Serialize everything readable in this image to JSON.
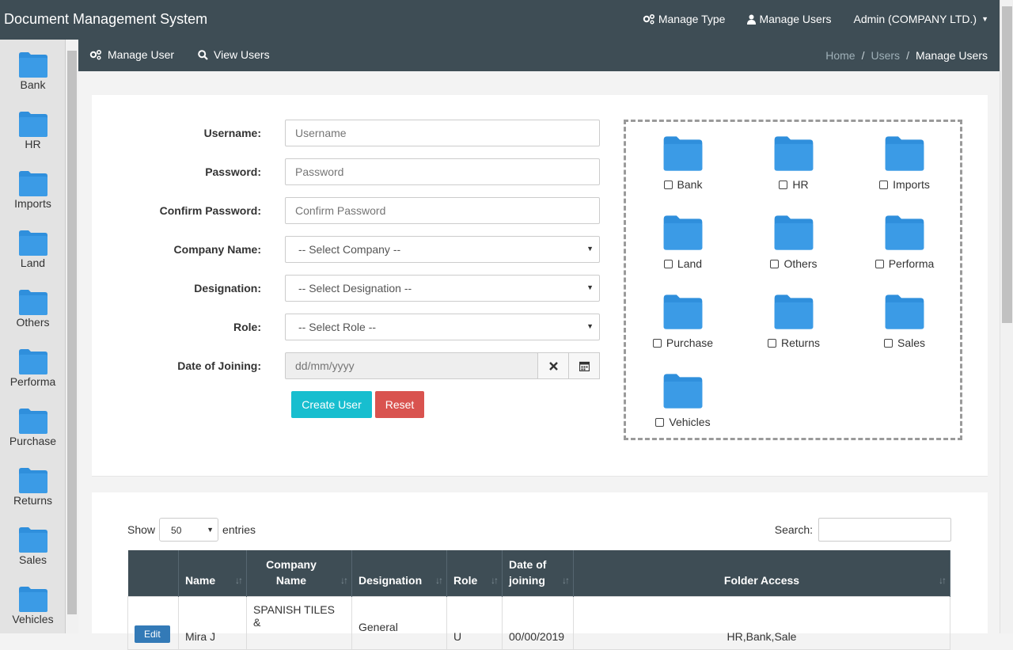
{
  "app": {
    "title": "Document Management System"
  },
  "topnav": {
    "manage_type": "Manage Type",
    "manage_users": "Manage Users",
    "account": "Admin (COMPANY LTD.)"
  },
  "sidebar": {
    "items": [
      {
        "label": "Bank"
      },
      {
        "label": "HR"
      },
      {
        "label": "Imports"
      },
      {
        "label": "Land"
      },
      {
        "label": "Others"
      },
      {
        "label": "Performa"
      },
      {
        "label": "Purchase"
      },
      {
        "label": "Returns"
      },
      {
        "label": "Sales"
      },
      {
        "label": "Vehicles"
      }
    ]
  },
  "subnav": {
    "manage_user": "Manage User",
    "view_users": "View Users",
    "breadcrumb": {
      "home": "Home",
      "users": "Users",
      "current": "Manage Users",
      "separator": "/"
    }
  },
  "form": {
    "username": {
      "label": "Username:",
      "placeholder": "Username"
    },
    "password": {
      "label": "Password:",
      "placeholder": "Password"
    },
    "confirm_password": {
      "label": "Confirm Password:",
      "placeholder": "Confirm Password"
    },
    "company": {
      "label": "Company Name:",
      "value": "-- Select Company --"
    },
    "designation": {
      "label": "Designation:",
      "value": "-- Select Designation --"
    },
    "role": {
      "label": "Role:",
      "value": "-- Select Role --"
    },
    "doj": {
      "label": "Date of Joining:",
      "placeholder": "dd/mm/yyyy"
    },
    "create_button": "Create User",
    "reset_button": "Reset"
  },
  "folders": [
    {
      "label": "Bank"
    },
    {
      "label": "HR"
    },
    {
      "label": "Imports"
    },
    {
      "label": "Land"
    },
    {
      "label": "Others"
    },
    {
      "label": "Performa"
    },
    {
      "label": "Purchase"
    },
    {
      "label": "Returns"
    },
    {
      "label": "Sales"
    },
    {
      "label": "Vehicles"
    }
  ],
  "table": {
    "show_label": "Show",
    "entries_value": "50",
    "entries_label": "entries",
    "search_label": "Search:",
    "columns": [
      "",
      "Name",
      "Company Name",
      "Designation",
      "Role",
      "Date of joining",
      "Folder Access"
    ],
    "rows": [
      {
        "action": "Edit",
        "name": "Mira J",
        "company": "SPANISH TILES &",
        "designation": "General",
        "role": "U",
        "doj": "00/00/2019",
        "access": "HR,Bank,Sale"
      }
    ]
  },
  "colors": {
    "header": "#3e4d55",
    "primary": "#17becf",
    "danger": "#d9534f",
    "folder": "#2f8fdc"
  }
}
